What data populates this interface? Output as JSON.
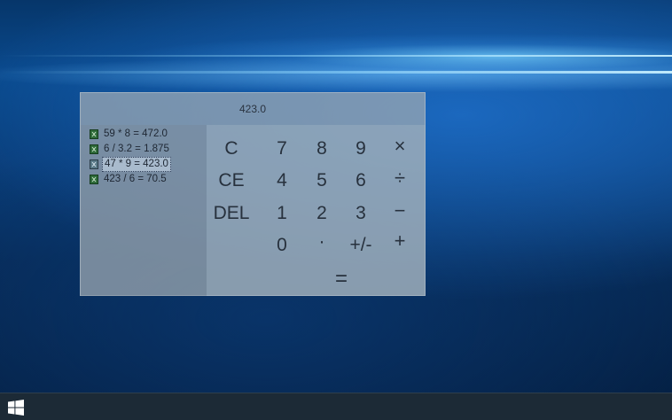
{
  "calculator": {
    "display": "423.0",
    "history": [
      {
        "expr": "59 * 8 = 472.0",
        "selected": false
      },
      {
        "expr": "6 / 3.2 = 1.875",
        "selected": false
      },
      {
        "expr": "47 * 9 = 423.0",
        "selected": true
      },
      {
        "expr": "423 / 6 = 70.5",
        "selected": false
      }
    ],
    "keys": {
      "clear": "C",
      "clear_entry": "CE",
      "delete": "DEL",
      "seven": "7",
      "eight": "8",
      "nine": "9",
      "four": "4",
      "five": "5",
      "six": "6",
      "one": "1",
      "two": "2",
      "three": "3",
      "zero": "0",
      "decimal": "·",
      "negate": "+/-",
      "multiply": "×",
      "divide": "÷",
      "subtract": "−",
      "add": "+",
      "equals": "="
    }
  },
  "colors": {
    "window_bg": "#96a5b4",
    "key_text": "#27313d",
    "taskbar": "#1c2a36"
  },
  "taskbar": {
    "start_icon": "windows-logo-icon"
  }
}
